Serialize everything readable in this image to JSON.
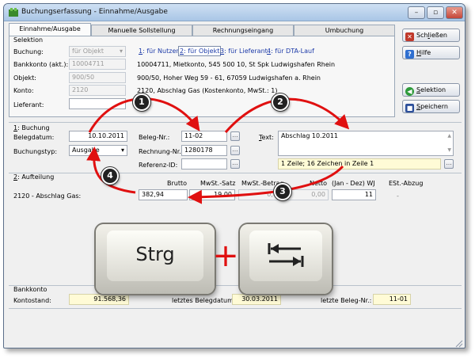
{
  "window": {
    "title": "Buchungserfassung - Einnahme/Ausgabe",
    "controls": {
      "minimize": "–",
      "maximize": "▫",
      "close": "✕"
    }
  },
  "tabs": [
    {
      "label": "Einnahme/Ausgabe",
      "active": true
    },
    {
      "label": "Manuelle Sollstellung",
      "active": false
    },
    {
      "label": "Rechnungseingang",
      "active": false
    },
    {
      "label": "Umbuchung",
      "active": false
    }
  ],
  "selektion": {
    "title": "Selektion",
    "buchung_label": "Buchung:",
    "buchung_value": "für Objekt",
    "bankkonto_label": "Bankkonto (akt.):",
    "bankkonto_value": "10004711",
    "objekt_label": "Objekt:",
    "objekt_value": "900/50",
    "konto_label": "Konto:",
    "konto_value": "2120",
    "lieferant_label": "Lieferant:",
    "lieferant_value": "",
    "link_tabs": [
      {
        "key": "1",
        "label": ": für Nutzer",
        "active": false
      },
      {
        "key": "2",
        "label": ": für Objekt",
        "active": true
      },
      {
        "key": "3",
        "label": ": für Lieferant",
        "active": false
      },
      {
        "key": "4",
        "label": ": für DTA-Lauf",
        "active": false
      }
    ],
    "info_bankkonto": "10004711,  Mietkonto,  545 500 10,  St Spk Ludwigshafen Rhein",
    "info_objekt": "900/50,  Hoher Weg 59 - 61, 67059 Ludwigshafen a. Rhein",
    "info_konto": "2120,  Abschlag Gas  (Kostenkonto,  MwSt.: 1)"
  },
  "buchung": {
    "title_key": "1",
    "title_rest": ": Buchung",
    "belegdatum_label": "Belegdatum:",
    "belegdatum_value": "10.10.2011",
    "buchungstyp_label": "Buchungstyp:",
    "buchungstyp_value": "Ausgabe",
    "belegnr_label": "Beleg-Nr.:",
    "belegnr_value": "11-02",
    "rechnungsnr_label": "Rechnung-Nr.:",
    "rechnungsnr_value": "1280178",
    "referenzid_label": "Referenz-ID:",
    "referenzid_value": "",
    "text_key": "T",
    "text_rest": "ext:",
    "text_value": "Abschlag 10.2011",
    "status_text": "1 Zeile; 16 Zeichen in Zeile 1"
  },
  "aufteilung": {
    "title_key": "2",
    "title_rest": ": Aufteilung",
    "columns": [
      "Brutto",
      "MwSt.-Satz",
      "MwSt.-Betrag",
      "Netto",
      "(Jan - Dez) WJ",
      "ESt.-Abzug"
    ],
    "row_label": "2120 - Abschlag Gas:",
    "brutto": "382,94",
    "mwst_satz": "19,00",
    "mwst_betrag": "0,00",
    "netto": "0,00",
    "wj": "11",
    "est_abzug": "-"
  },
  "bankkonto": {
    "title": "Bankkonto",
    "kontostand_label": "Kontostand:",
    "kontostand_value": "91.568,36",
    "belegdatum_label": "letztes Belegdatum:",
    "belegdatum_value": "30.03.2011",
    "belegnr_label": "letzte Beleg-Nr.:",
    "belegnr_value": "11-01"
  },
  "buttons": {
    "schliessen_pre": "Sch",
    "schliessen_key": "l",
    "schliessen_post": "ießen",
    "hilfe_key": "H",
    "hilfe_rest": "ilfe",
    "selektion_key": "S",
    "selektion_rest": "elektion",
    "speichern_key": "S",
    "speichern_rest": "peichern"
  },
  "overlay": {
    "key_strg": "Strg",
    "plus": "+",
    "markers": [
      "1",
      "2",
      "3",
      "4"
    ]
  },
  "colors": {
    "arrow": "#e01010",
    "titlebar": "#b8d0ec",
    "highlight_yellow": "#fffbd6"
  }
}
